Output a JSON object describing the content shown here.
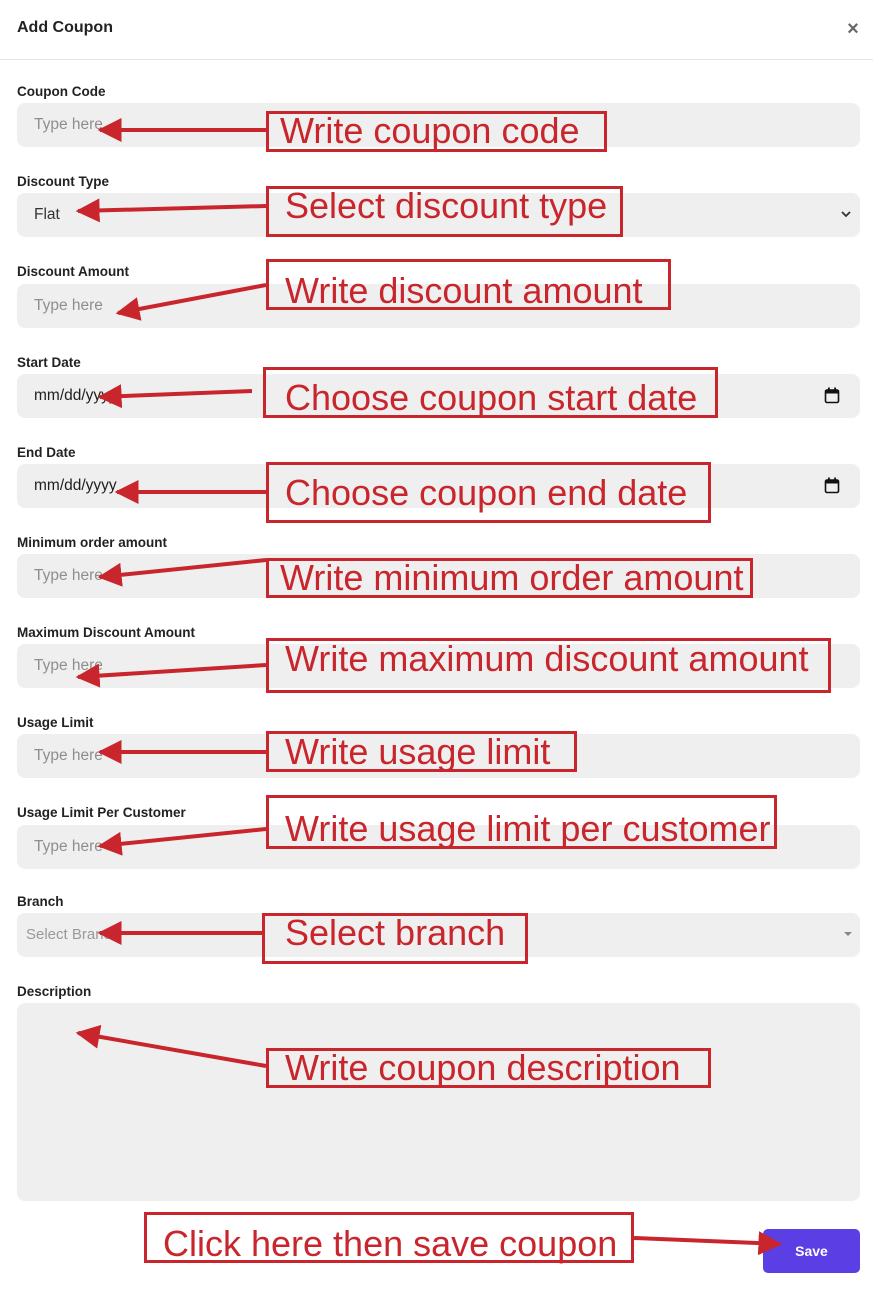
{
  "modal": {
    "title": "Add Coupon",
    "close_glyph": "×"
  },
  "fields": {
    "coupon_code": {
      "label": "Coupon Code",
      "placeholder": "Type here"
    },
    "discount_type": {
      "label": "Discount Type",
      "value": "Flat"
    },
    "discount_amount": {
      "label": "Discount Amount",
      "placeholder": "Type here"
    },
    "start_date": {
      "label": "Start Date",
      "placeholder": "mm/dd/yyyy"
    },
    "end_date": {
      "label": "End Date",
      "placeholder": "mm/dd/yyyy"
    },
    "min_order_amount": {
      "label": "Minimum order amount",
      "placeholder": "Type here"
    },
    "max_discount_amount": {
      "label": "Maximum Discount Amount",
      "placeholder": "Type here"
    },
    "usage_limit": {
      "label": "Usage Limit",
      "placeholder": "Type here"
    },
    "usage_limit_per_customer": {
      "label": "Usage Limit Per Customer",
      "placeholder": "Type here"
    },
    "branch": {
      "label": "Branch",
      "placeholder": "Select Branch"
    },
    "description": {
      "label": "Description"
    }
  },
  "actions": {
    "save_label": "Save"
  },
  "annotations": {
    "coupon_code": "Write coupon code",
    "discount_type": "Select discount type",
    "discount_amount": "Write discount amount",
    "start_date": "Choose coupon start date",
    "end_date": "Choose coupon end date",
    "min_order_amount": "Write minimum order amount",
    "max_discount_amount": "Write maximum discount amount",
    "usage_limit": "Write usage limit",
    "usage_limit_per_customer": "Write usage limit per customer",
    "branch": "Select branch",
    "description": "Write coupon description",
    "save": "Click here then save coupon"
  },
  "colors": {
    "annotation": "#c8262c",
    "save_button": "#5b3fe4",
    "field_bg": "#efefef"
  },
  "icons": {
    "close": "close-icon",
    "select": "chevron-down-icon",
    "date": "calendar-icon",
    "branch": "caret-down-icon"
  }
}
